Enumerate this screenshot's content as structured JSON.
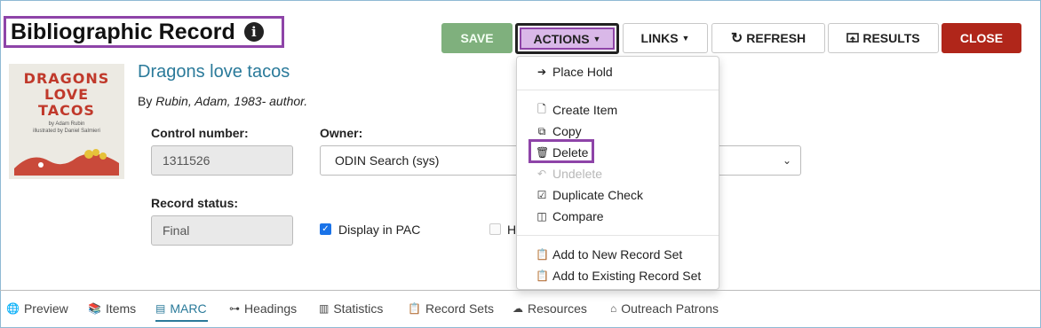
{
  "header": {
    "title": "Bibliographic Record",
    "info_icon": "info-circle-icon"
  },
  "toolbar": {
    "save_label": "SAVE",
    "actions_label": "ACTIONS",
    "links_label": "LINKS",
    "refresh_label": "REFRESH",
    "results_label": "RESULTS",
    "close_label": "CLOSE",
    "caret_icon": "caret-down-icon",
    "refresh_icon": "refresh-icon",
    "results_icon": "results-icon"
  },
  "colors": {
    "save": "#7fb07d",
    "actions_highlight": "#d9b8e8",
    "highlight_border": "#8e44a8",
    "close": "#b0261a",
    "link": "#2a7a9a"
  },
  "record": {
    "cover_text_line1": "DRAGONS",
    "cover_text_line2": "LOVE",
    "cover_text_line3": "TACOS",
    "cover_sub_line1": "by Adam Rubin",
    "cover_sub_line2": "illustrated by Daniel Salmieri",
    "title": "Dragons love tacos",
    "author_prefix": "By ",
    "author": "Rubin, Adam, 1983- author."
  },
  "form": {
    "control_number_label": "Control number:",
    "control_number_value": "1311526",
    "owner_label": "Owner:",
    "owner_value": "ODIN Search (sys)",
    "record_status_label": "Record status:",
    "record_status_value": "Final",
    "display_pac_label": "Display in PAC",
    "display_pac_checked": true,
    "hidden_checkbox_label": "H"
  },
  "actions_menu": {
    "items": [
      {
        "label": "Place Hold",
        "icon": "sign-in-icon",
        "enabled": true
      },
      {
        "label": "Create Item",
        "icon": "file-plus-icon",
        "enabled": true
      },
      {
        "label": "Copy",
        "icon": "copy-icon",
        "enabled": true
      },
      {
        "label": "Delete",
        "icon": "trash-icon",
        "enabled": true
      },
      {
        "label": "Undelete",
        "icon": "undo-icon",
        "enabled": false
      },
      {
        "label": "Duplicate Check",
        "icon": "duplicate-check-icon",
        "enabled": true
      },
      {
        "label": "Compare",
        "icon": "compare-icon",
        "enabled": true
      },
      {
        "label": "Add to New Record Set",
        "icon": "clipboard-icon",
        "enabled": true
      },
      {
        "label": "Add to Existing Record Set",
        "icon": "clipboard-filled-icon",
        "enabled": true
      }
    ]
  },
  "tabs": [
    {
      "label": "Preview",
      "icon": "globe-icon"
    },
    {
      "label": "Items",
      "icon": "books-icon"
    },
    {
      "label": "MARC",
      "icon": "marc-icon",
      "active": true
    },
    {
      "label": "Headings",
      "icon": "sitemap-icon"
    },
    {
      "label": "Statistics",
      "icon": "bar-chart-icon"
    },
    {
      "label": "Record Sets",
      "icon": "clipboard-icon"
    },
    {
      "label": "Resources",
      "icon": "cloud-icon"
    },
    {
      "label": "Outreach Patrons",
      "icon": "house-icon"
    }
  ]
}
